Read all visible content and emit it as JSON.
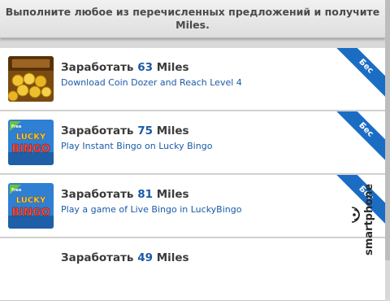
{
  "header": {
    "text": "Выполните любое из перечисленных предложений и получите Miles."
  },
  "offers": [
    {
      "prefix": "Заработать",
      "amount": "63",
      "suffix": "Miles",
      "description": "Download Coin Dozer and Reach Level 4",
      "badge": "Бес",
      "icon": "coin-dozer-icon"
    },
    {
      "prefix": "Заработать",
      "amount": "75",
      "suffix": "Miles",
      "description": "Play Instant Bingo on Lucky Bingo",
      "badge": "Бес",
      "icon": "lucky-bingo-icon"
    },
    {
      "prefix": "Заработать",
      "amount": "81",
      "suffix": "Miles",
      "description": "Play a game of Live Bingo in LuckyBingo",
      "badge": "Бес",
      "icon": "lucky-bingo-icon"
    },
    {
      "prefix": "Заработать",
      "amount": "49",
      "suffix": "Miles",
      "description": "",
      "badge": "",
      "icon": ""
    }
  ],
  "watermark": {
    "text": "smartphone"
  },
  "colors": {
    "accent": "#1a5aa8",
    "badge": "#1b6dc4",
    "header_bg": "#e8e8e8"
  }
}
